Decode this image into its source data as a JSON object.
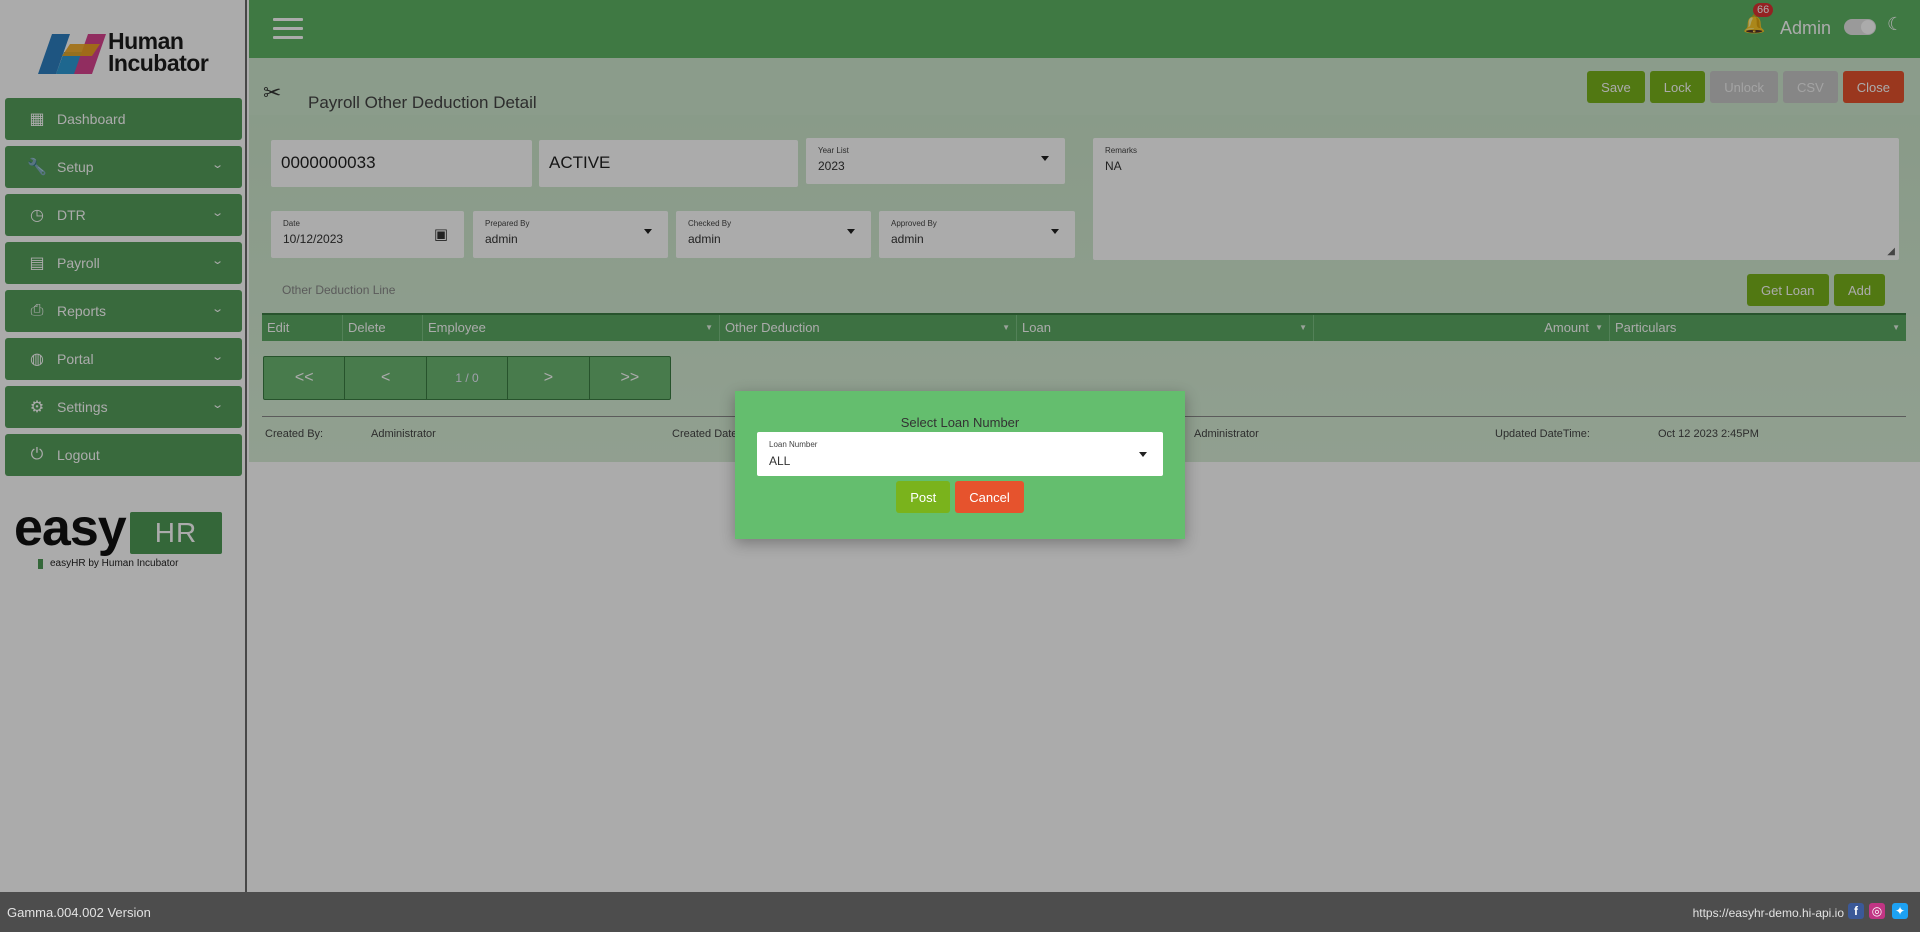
{
  "brand": {
    "name_line1": "Human",
    "name_line2": "Incubator",
    "product_word": "easy",
    "product_box": "HR",
    "byline": "easyHR by Human Incubator"
  },
  "sidebar": {
    "items": [
      {
        "label": "Dashboard",
        "icon": "dashboard-icon",
        "expandable": false
      },
      {
        "label": "Setup",
        "icon": "wrench-icon",
        "expandable": true
      },
      {
        "label": "DTR",
        "icon": "clock-icon",
        "expandable": true
      },
      {
        "label": "Payroll",
        "icon": "payroll-icon",
        "expandable": true
      },
      {
        "label": "Reports",
        "icon": "printer-icon",
        "expandable": true
      },
      {
        "label": "Portal",
        "icon": "globe-icon",
        "expandable": true
      },
      {
        "label": "Settings",
        "icon": "gear-icon",
        "expandable": true
      },
      {
        "label": "Logout",
        "icon": "power-icon",
        "expandable": false
      }
    ]
  },
  "topbar": {
    "notification_count": "66",
    "user_label": "Admin"
  },
  "page": {
    "title": "Payroll Other Deduction Detail",
    "buttons": {
      "save": "Save",
      "lock": "Lock",
      "unlock": "Unlock",
      "csv": "CSV",
      "close": "Close"
    }
  },
  "form": {
    "number": "0000000033",
    "status": "ACTIVE",
    "year_list": {
      "label": "Year List",
      "value": "2023"
    },
    "remarks": {
      "label": "Remarks",
      "value": "NA"
    },
    "date": {
      "label": "Date",
      "value": "10/12/2023"
    },
    "prepared_by": {
      "label": "Prepared By",
      "value": "admin"
    },
    "checked_by": {
      "label": "Checked By",
      "value": "admin"
    },
    "approved_by": {
      "label": "Approved By",
      "value": "admin"
    }
  },
  "lines": {
    "label": "Other Deduction Line",
    "get_loan": "Get Loan",
    "add": "Add",
    "columns": [
      "Edit",
      "Delete",
      "Employee",
      "Other Deduction",
      "Loan",
      "Amount",
      "Particulars"
    ],
    "pager": {
      "first": "<<",
      "prev": "<",
      "info": "1 / 0",
      "next": ">",
      "last": ">>"
    }
  },
  "audit": {
    "created_by_label": "Created By:",
    "created_by_value": "Administrator",
    "created_date_label": "Created Date",
    "updated_by_value": "Administrator",
    "updated_datetime_label": "Updated DateTime:",
    "updated_datetime_value": "Oct 12 2023 2:45PM"
  },
  "modal": {
    "title": "Select Loan Number",
    "field_label": "Loan Number",
    "field_value": "ALL",
    "post": "Post",
    "cancel": "Cancel"
  },
  "footer": {
    "version": "Gamma.004.002 Version",
    "site": "https://easyhr-demo.hi-api.io"
  },
  "colors": {
    "primary": "#5fb565",
    "nav": "#559e5b",
    "accent_green": "#7ab31c",
    "danger": "#e6532d",
    "modal": "#64be6e"
  }
}
